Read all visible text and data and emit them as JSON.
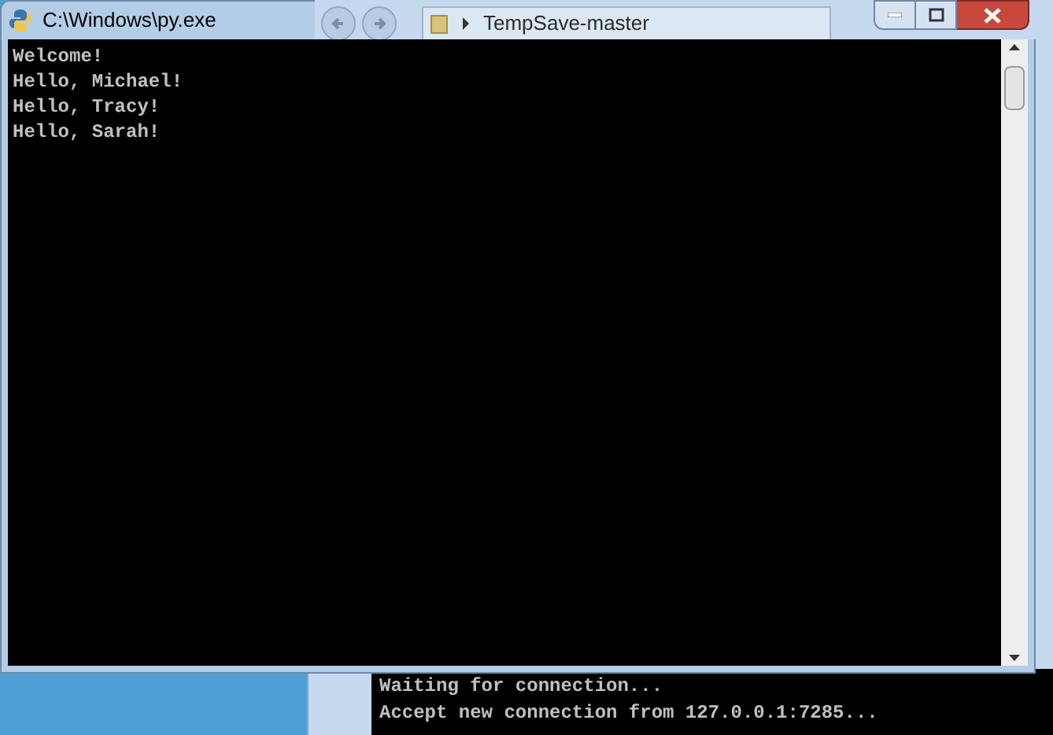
{
  "back_window": {
    "breadcrumb": "TempSave-master",
    "console_lines": [
      "Waiting for connection...",
      "Accept new connection from 127.0.0.1:7285..."
    ]
  },
  "window": {
    "title": "C:\\Windows\\py.exe",
    "console_lines": [
      "Welcome!",
      "Hello, Michael!",
      "Hello, Tracy!",
      "Hello, Sarah!"
    ]
  }
}
